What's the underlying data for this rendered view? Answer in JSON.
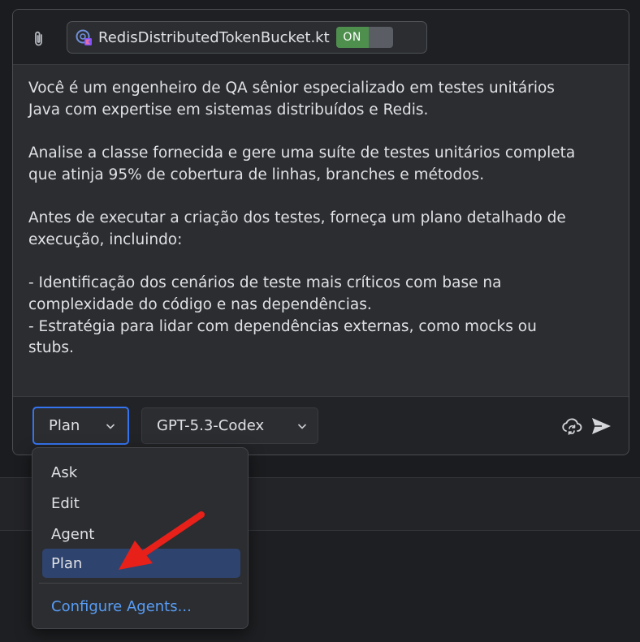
{
  "context": {
    "file_name": "RedisDistributedTokenBucket.kt",
    "toggle_label": "ON",
    "toggle_on": true
  },
  "prompt": {
    "text": "Você é um engenheiro de QA sênior especializado em testes unitários\nJava com expertise em sistemas distribuídos e Redis.\n\nAnalise a classe fornecida e gere uma suíte de testes unitários completa\nque atinja 95% de cobertura de linhas, branches e métodos.\n\nAntes de executar a criação dos testes, forneça um plano detalhado de\nexecução, incluindo:\n\n- Identificação dos cenários de teste mais críticos com base na\ncomplexidade do código e nas dependências.\n- Estratégia para lidar com dependências externas, como mocks ou\nstubs."
  },
  "toolbar": {
    "mode_value": "Plan",
    "model_value": "GPT-5.3-Codex"
  },
  "mode_menu": {
    "items": [
      {
        "label": "Ask",
        "selected": false
      },
      {
        "label": "Edit",
        "selected": false
      },
      {
        "label": "Agent",
        "selected": false
      },
      {
        "label": "Plan",
        "selected": true
      }
    ],
    "configure_label": "Configure Agents..."
  },
  "colors": {
    "accent": "#3574f0",
    "toggle_on": "#4e8f4e",
    "selected_item": "#2e436e",
    "link": "#589df6",
    "annotation_arrow": "#e8201a"
  },
  "icons": [
    "paperclip-icon",
    "file-kotlin-icon",
    "chevron-down-icon",
    "cloud-sync-icon",
    "send-icon",
    "red-arrow-annotation"
  ]
}
